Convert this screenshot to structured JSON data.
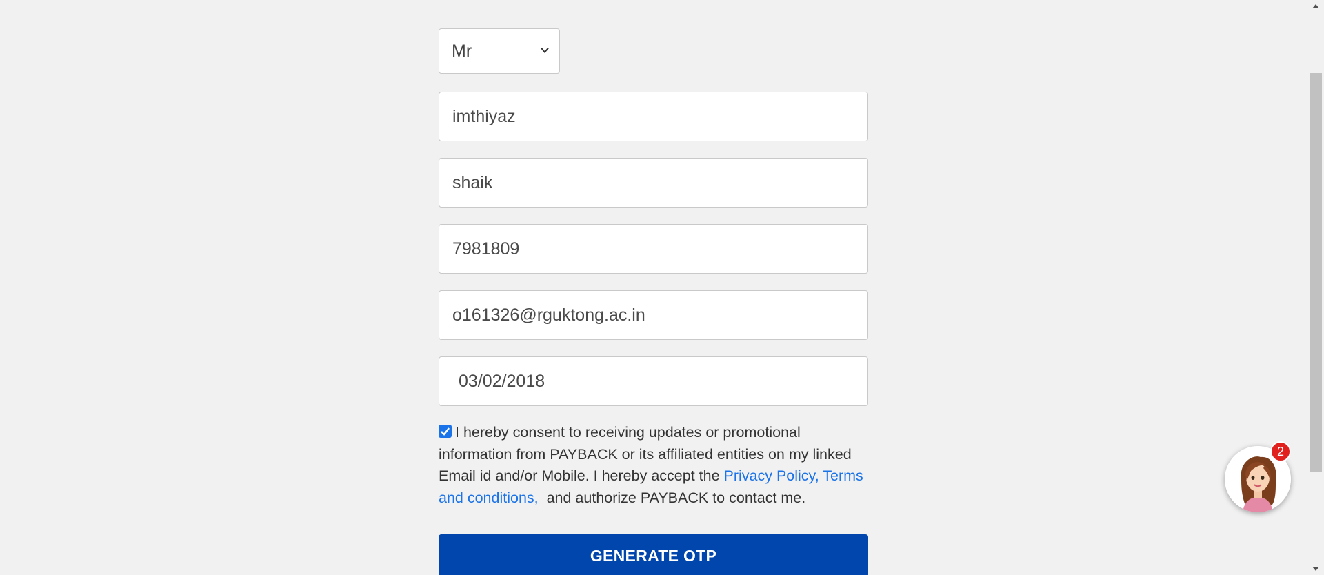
{
  "form": {
    "title_select": {
      "value": "Mr"
    },
    "first_name": {
      "value": "imthiyaz"
    },
    "last_name": {
      "value": "shaik"
    },
    "mobile": {
      "value": "7981809"
    },
    "email": {
      "value": "o161326@rguktong.ac.in"
    },
    "dob": {
      "value": "03/02/2018"
    },
    "consent": {
      "checked": true,
      "text_before": "I hereby consent to receiving updates or promotional information from PAYBACK or its affiliated entities on my linked Email id and/or Mobile. I hereby accept the ",
      "link_text": "Privacy Policy, Terms and conditions,",
      "text_after": "  and authorize PAYBACK to contact me."
    },
    "submit_label": "GENERATE OTP"
  },
  "chat": {
    "badge_count": "2",
    "icon": "assistant-avatar-icon"
  },
  "colors": {
    "page_background": "#f1f1f1",
    "button_primary": "#0046ad",
    "link": "#1a73e8",
    "badge": "#e0211d"
  }
}
